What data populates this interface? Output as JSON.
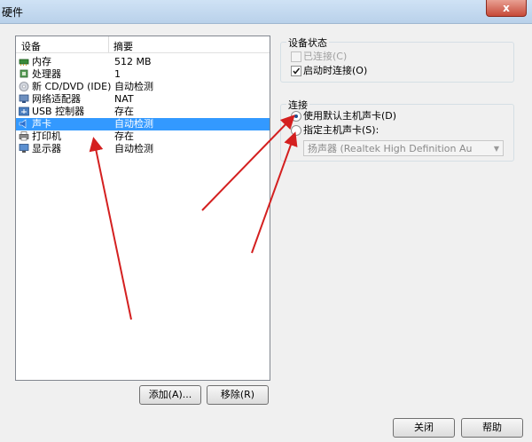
{
  "window": {
    "title": "硬件",
    "close_label": "x"
  },
  "device_list": {
    "headers": [
      "设备",
      "摘要"
    ],
    "rows": [
      {
        "name": "内存",
        "summary": "512 MB",
        "icon": "memory-icon"
      },
      {
        "name": "处理器",
        "summary": "1",
        "icon": "processor-icon"
      },
      {
        "name": "新 CD/DVD (IDE)",
        "summary": "自动检测",
        "icon": "cd-dvd-icon"
      },
      {
        "name": "网络适配器",
        "summary": "NAT",
        "icon": "network-adapter-icon"
      },
      {
        "name": "USB 控制器",
        "summary": "存在",
        "icon": "usb-icon"
      },
      {
        "name": "声卡",
        "summary": "自动检测",
        "icon": "sound-card-icon",
        "selected": true
      },
      {
        "name": "打印机",
        "summary": "存在",
        "icon": "printer-icon"
      },
      {
        "name": "显示器",
        "summary": "自动检测",
        "icon": "display-icon"
      }
    ]
  },
  "buttons": {
    "add": "添加(A)...",
    "remove": "移除(R)",
    "close": "关闭",
    "help": "帮助"
  },
  "device_status": {
    "title": "设备状态",
    "connected_label": "已连接(C)",
    "connected_checked": false,
    "connected_disabled": true,
    "connect_on_startup_label": "启动时连接(O)",
    "connect_on_startup_checked": true
  },
  "connection": {
    "title": "连接",
    "default_label": "使用默认主机声卡(D)",
    "default_selected": true,
    "specify_label": "指定主机声卡(S):",
    "specify_selected": false,
    "host_card_value": "扬声器 (Realtek High Definition Au"
  },
  "colors": {
    "selection": "#3399ff",
    "annotation_arrow": "#d42020"
  }
}
